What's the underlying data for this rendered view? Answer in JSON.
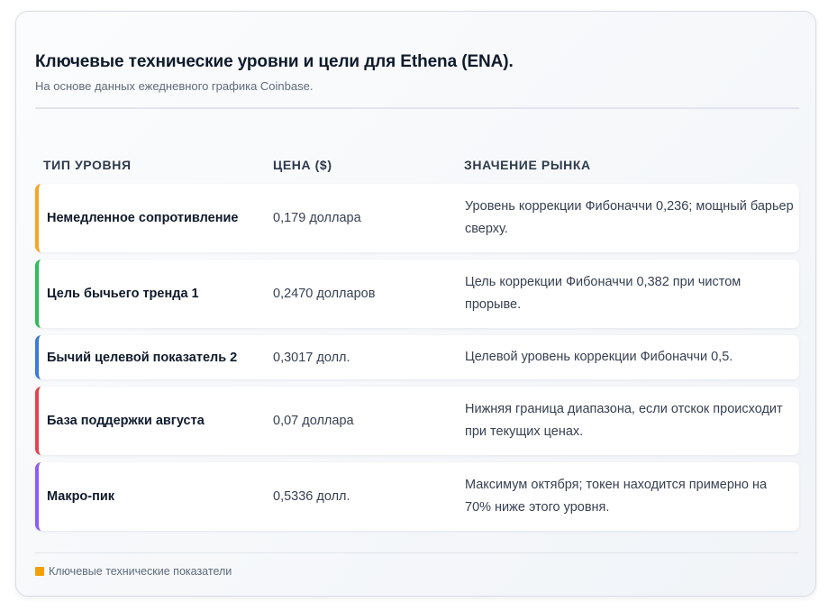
{
  "header": {
    "title": "Ключевые технические уровни и цели для Ethena (ENA).",
    "subtitle": "На основе данных ежедневного графика Coinbase."
  },
  "table": {
    "columns": [
      "Тип уровня",
      "Цена ($)",
      "Значение рынка"
    ],
    "rows": [
      {
        "type": "Немедленное сопротивление",
        "price": "0,179 доллара",
        "meaning": "Уровень коррекции Фибоначчи 0,236; мощный барьер сверху.",
        "accent": "#f5a623"
      },
      {
        "type": "Цель бычьего тренда 1",
        "price": "0,2470 долларов",
        "meaning": "Цель коррекции Фибоначчи 0,382 при чистом прорыве.",
        "accent": "#2ebd5b"
      },
      {
        "type": "Бычий целевой показатель 2",
        "price": "0,3017 долл.",
        "meaning": "Целевой уровень коррекции Фибоначчи 0,5.",
        "accent": "#3b7bd8"
      },
      {
        "type": "База поддержки августа",
        "price": "0,07 доллара",
        "meaning": "Нижняя граница диапазона, если отскок происходит при текущих ценах.",
        "accent": "#e0474c"
      },
      {
        "type": "Макро-пик",
        "price": "0,5336 долл.",
        "meaning": "Максимум октября; токен находится примерно на 70% ниже этого уровня.",
        "accent": "#8b5cf6"
      }
    ]
  },
  "legend": {
    "label": "Ключевые технические показатели",
    "color": "#f59e0b"
  }
}
